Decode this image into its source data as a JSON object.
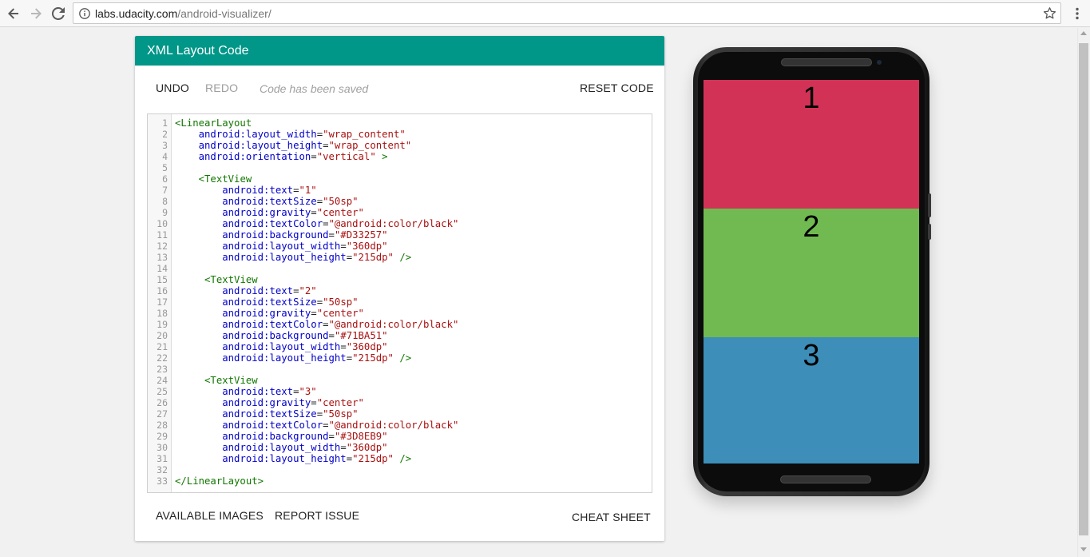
{
  "browser": {
    "url_host": "labs.udacity.com",
    "url_path": "/android-visualizer/"
  },
  "editor": {
    "title": "XML Layout Code",
    "undo_label": "UNDO",
    "redo_label": "REDO",
    "saved_message": "Code has been saved",
    "reset_label": "RESET CODE",
    "available_images_label": "AVAILABLE IMAGES",
    "report_issue_label": "REPORT ISSUE",
    "cheat_sheet_label": "CHEAT SHEET",
    "code_lines": [
      "<LinearLayout",
      "    android:layout_width=\"wrap_content\"",
      "    android:layout_height=\"wrap_content\"",
      "    android:orientation=\"vertical\" >",
      "",
      "    <TextView",
      "        android:text=\"1\"",
      "        android:textSize=\"50sp\"",
      "        android:gravity=\"center\"",
      "        android:textColor=\"@android:color/black\"",
      "        android:background=\"#D33257\"",
      "        android:layout_width=\"360dp\"",
      "        android:layout_height=\"215dp\" />",
      "",
      "     <TextView",
      "        android:text=\"2\"",
      "        android:textSize=\"50sp\"",
      "        android:gravity=\"center\"",
      "        android:textColor=\"@android:color/black\"",
      "        android:background=\"#71BA51\"",
      "        android:layout_width=\"360dp\"",
      "        android:layout_height=\"215dp\" />",
      "",
      "     <TextView",
      "        android:text=\"3\"",
      "        android:gravity=\"center\"",
      "        android:textSize=\"50sp\"",
      "        android:textColor=\"@android:color/black\"",
      "        android:background=\"#3D8EB9\"",
      "        android:layout_width=\"360dp\"",
      "        android:layout_height=\"215dp\" />",
      "",
      "</LinearLayout>"
    ]
  },
  "preview": {
    "views": [
      {
        "text": "1",
        "color": "#D33257"
      },
      {
        "text": "2",
        "color": "#71BA51"
      },
      {
        "text": "3",
        "color": "#3D8EB9"
      }
    ]
  },
  "colors": {
    "header": "#009688",
    "tag": "#117700",
    "attribute": "#0000cc",
    "string": "#aa1111"
  }
}
